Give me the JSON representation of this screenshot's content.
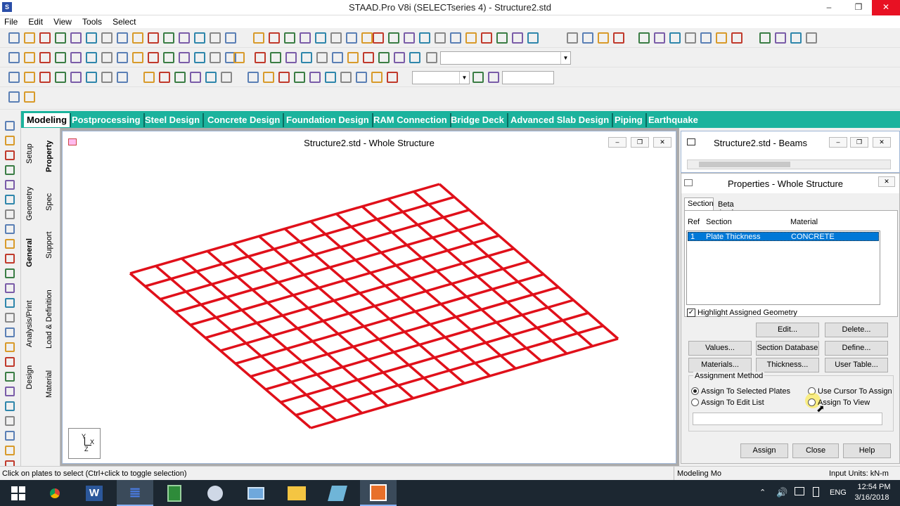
{
  "app": {
    "title": "STAAD.Pro V8i (SELECTseries 4) - Structure2.std"
  },
  "menu": [
    "File",
    "Edit",
    "View",
    "Tools",
    "Select"
  ],
  "tabs": [
    "Modeling",
    "Postprocessing",
    "Steel Design",
    "Concrete Design",
    "Foundation Design",
    "RAM Connection",
    "Bridge Deck",
    "Advanced Slab Design",
    "Piping",
    "Earthquake"
  ],
  "vertical_tabs": {
    "outer": [
      "Setup",
      "Geometry",
      "General",
      "Analysis/Print",
      "Design"
    ],
    "inner": [
      "Property",
      "Spec",
      "Support",
      "Load & Definition",
      "Material"
    ]
  },
  "viewport": {
    "title": "Structure2.std - Whole Structure",
    "axis_label": "Y\n X\nZ",
    "grid_color": "#e0101a"
  },
  "beams_window": {
    "title": "Structure2.std - Beams"
  },
  "properties": {
    "title": "Properties - Whole Structure",
    "tabs": [
      "Section",
      "Beta Angle"
    ],
    "columns": {
      "ref": "Ref",
      "section": "Section",
      "material": "Material"
    },
    "rows": [
      {
        "ref": "1",
        "section": "Plate Thickness",
        "material": "CONCRETE"
      }
    ],
    "highlight_label": "Highlight Assigned Geometry",
    "buttons": {
      "edit": "Edit...",
      "delete": "Delete...",
      "values": "Values...",
      "section_database": "Section Database",
      "define": "Define...",
      "materials": "Materials...",
      "thickness": "Thickness...",
      "user_table": "User Table..."
    },
    "assignment": {
      "group_label": "Assignment Method",
      "selected_plates": "Assign To Selected Plates",
      "edit_list": "Assign To Edit List",
      "use_cursor": "Use Cursor To Assign",
      "to_view": "Assign To View"
    },
    "footer": {
      "assign": "Assign",
      "close": "Close",
      "help": "Help"
    }
  },
  "status": {
    "left": "Click on plates to select (Ctrl+click to toggle selection)",
    "mode": "Modeling Mo",
    "units": "Input Units:  kN-m"
  },
  "taskbar": {
    "lang": "ENG",
    "time": "12:54 PM",
    "date": "3/16/2018"
  },
  "colors": {
    "accent_tabs": "#1bb39d",
    "selection": "#0078d7",
    "grid": "#e0101a"
  }
}
